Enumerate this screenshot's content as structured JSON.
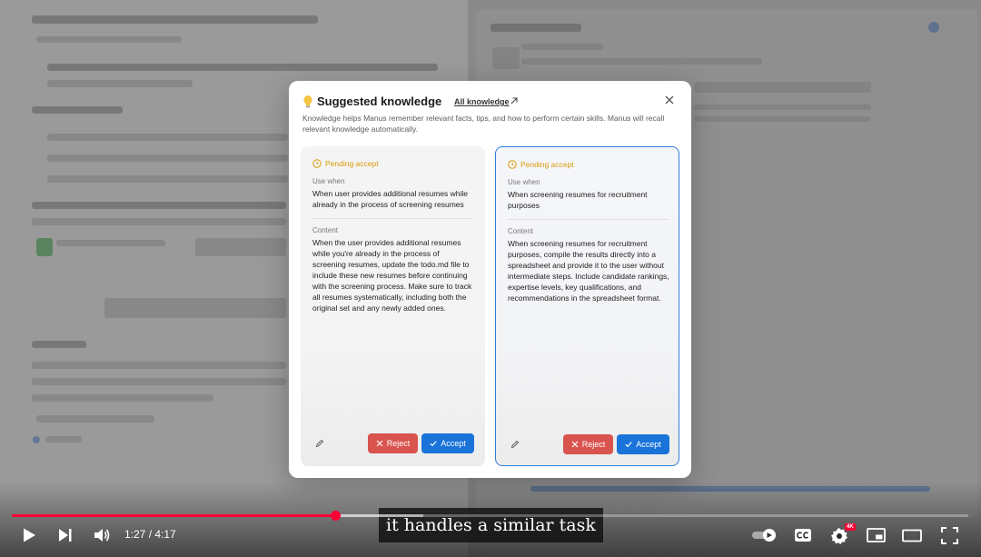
{
  "modal": {
    "title": "Suggested knowledge",
    "all_link": "All knowledge",
    "description": "Knowledge helps Manus remember relevant facts, tips, and how to perform certain skills. Manus will recall relevant knowledge automatically.",
    "icons": {
      "title": "lightbulb-icon",
      "link": "arrow-up-right-icon",
      "close": "close-icon"
    },
    "cards": [
      {
        "status": "Pending accept",
        "use_when_label": "Use when",
        "use_when": "When user provides additional resumes while already in the process of screening resumes",
        "content_label": "Content",
        "content": "When the user provides additional resumes while you're already in the process of screening resumes, update the todo.md file to include these new resumes before continuing with the screening process. Make sure to track all resumes systematically, including both the original set and any newly added ones.",
        "reject_label": "Reject",
        "accept_label": "Accept",
        "selected": false
      },
      {
        "status": "Pending accept",
        "use_when_label": "Use when",
        "use_when": "When screening resumes for recruitment purposes",
        "content_label": "Content",
        "content": "When screening resumes for recruitment purposes, compile the results directly into a spreadsheet and provide it to the user without intermediate steps. Include candidate rankings, expertise levels, key qualifications, and recommendations in the spreadsheet format.",
        "reject_label": "Reject",
        "accept_label": "Accept",
        "selected": true
      }
    ]
  },
  "player": {
    "caption": "it handles a similar task",
    "time": "1:27 / 4:17",
    "progress": 0.338,
    "buffered": 0.43,
    "quality_badge": "4K",
    "colors": {
      "progress": "#ff0033",
      "accent": "#1a73d9",
      "reject": "#d9534f",
      "pending": "#d99a07"
    }
  }
}
